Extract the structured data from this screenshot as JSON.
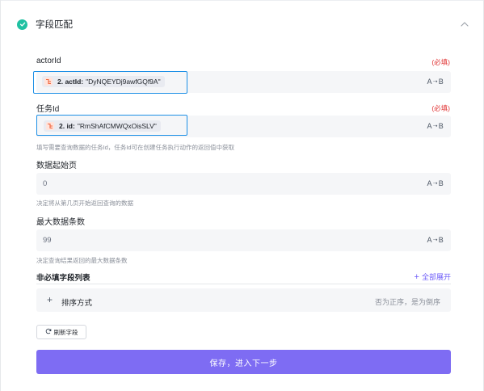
{
  "header": {
    "title": "字段匹配"
  },
  "fields": {
    "actorId": {
      "label": "actorId",
      "required": "(必填)",
      "chip_step": "2. actId:",
      "chip_value": "\"DyNQEYDj9awfGQf9A\""
    },
    "task": {
      "label": "任务Id",
      "required": "(必填)",
      "chip_step": "2. id:",
      "chip_value": "\"RmShAfCMWQxOisSLV\"",
      "hint": "填写需要查询数据的任务Id，任务Id可在创建任务执行动作的返回值中获取"
    },
    "start_page": {
      "label": "数据起始页",
      "value": "0",
      "hint": "决定将从第几页开始返回查询的数据"
    },
    "max_rows": {
      "label": "最大数据条数",
      "value": "99",
      "hint": "决定查询结果返回的最大数据条数"
    }
  },
  "type_toggle": {
    "a": "A",
    "b": "B"
  },
  "optional": {
    "title": "非必填字段列表",
    "expand_all": "全部展开",
    "sort_label": "排序方式",
    "sort_desc": "否为正序，是为倒序"
  },
  "refresh_label": "刷新字段",
  "submit_label": "保存，进入下一步",
  "colors": {
    "accent": "#7e6cf3",
    "success": "#20c1a2",
    "required": "#e03131",
    "highlight": "#1d8fe6"
  },
  "icons": {
    "header": "check-circle-icon",
    "collapse": "chevron-up-icon",
    "chip": "step-node-icon",
    "toggle": "arrow-right-icon",
    "expand": "plus-icon",
    "refresh": "refresh-icon"
  }
}
